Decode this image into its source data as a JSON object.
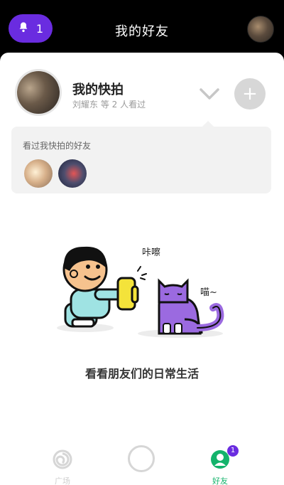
{
  "header": {
    "notification_count": "1",
    "title": "我的好友"
  },
  "kuaipai": {
    "title": "我的快拍",
    "subtitle": "刘耀东 等 2 人看过",
    "add_symbol": "+"
  },
  "viewers": {
    "label": "看过我快拍的好友",
    "count": 2
  },
  "illustration": {
    "camera_sound": "咔嚓",
    "cat_sound": "喵~",
    "caption": "看看朋友们的日常生活"
  },
  "bottom_nav": {
    "items": [
      {
        "label": "广场",
        "icon": "swirl-icon"
      },
      {
        "label": "",
        "icon": "shutter-icon"
      },
      {
        "label": "好友",
        "icon": "friends-icon",
        "badge": "1"
      }
    ]
  },
  "colors": {
    "accent": "#6a2ce0",
    "active": "#13b36b",
    "cat": "#9b6ae0"
  }
}
